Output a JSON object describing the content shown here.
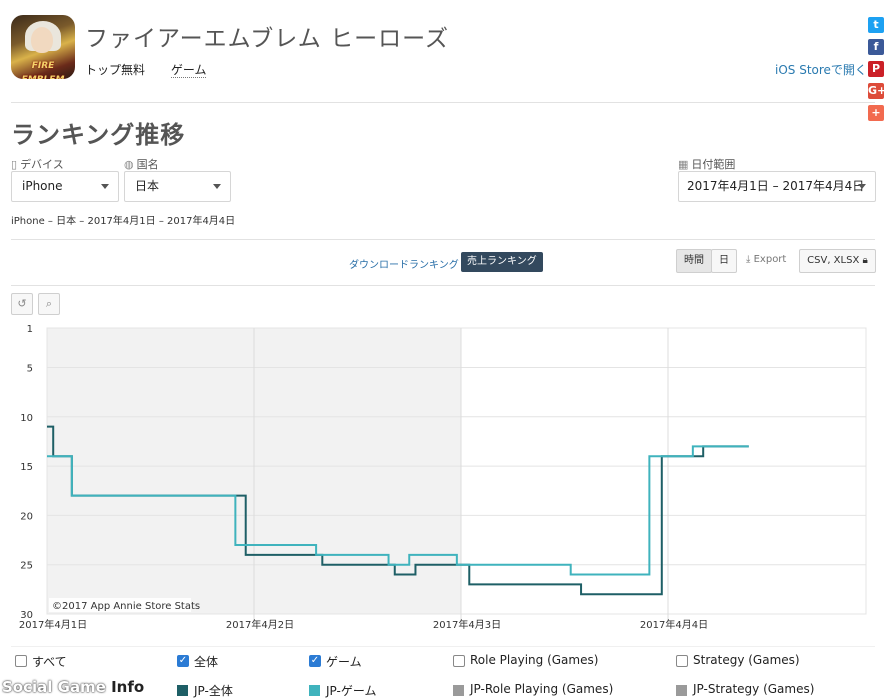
{
  "app": {
    "title": "ファイアーエムブレム ヒーローズ",
    "category": "トップ無料",
    "genre": "ゲーム",
    "store_link": "iOS Storeで開く",
    "icon_text": "FIRE EMBLEM Heroes"
  },
  "social": [
    {
      "name": "twitter-icon",
      "glyph": "t",
      "color": "#1da1f2"
    },
    {
      "name": "facebook-icon",
      "glyph": "f",
      "color": "#3b5998"
    },
    {
      "name": "pinterest-icon",
      "glyph": "P",
      "color": "#cb2027"
    },
    {
      "name": "google-plus-icon",
      "glyph": "G+",
      "color": "#dd4b39"
    },
    {
      "name": "share-plus-icon",
      "glyph": "+",
      "color": "#f26a4f"
    }
  ],
  "section_title": "ランキング推移",
  "filters": {
    "device_label": "デバイス",
    "device_value": "iPhone",
    "country_label": "国名",
    "country_value": "日本",
    "date_label": "日付範囲",
    "date_value": "2017年4月1日 – 2017年4月4日"
  },
  "summary": "iPhone – 日本 – 2017年4月1日 – 2017年4月4日",
  "ranking_tabs": {
    "download": "ダウンロードランキング",
    "revenue": "売上ランキング"
  },
  "buttons": {
    "hourly": "時間",
    "daily": "日",
    "export": "Export",
    "csv": "CSV, XLSX"
  },
  "tools": {
    "reset_glyph": "↺",
    "zoom_glyph": "⌕"
  },
  "chart_data": {
    "type": "line",
    "y_reversed": true,
    "ylim": [
      1,
      30
    ],
    "y_ticks": [
      1,
      5,
      10,
      15,
      20,
      25,
      30
    ],
    "x_range_days": [
      0,
      4
    ],
    "x_ticks": [
      {
        "day": 0,
        "label": "2017年4月1日"
      },
      {
        "day": 1,
        "label": "2017年4月2日"
      },
      {
        "day": 2,
        "label": "2017年4月3日"
      },
      {
        "day": 3,
        "label": "2017年4月4日"
      }
    ],
    "shaded_days": [
      [
        0,
        1
      ],
      [
        1,
        2
      ]
    ],
    "credit": "©2017 App Annie Store Stats",
    "series": [
      {
        "name": "JP-全体",
        "color": "#1e5f66",
        "step": true,
        "points": [
          [
            0.0,
            11
          ],
          [
            0.03,
            14
          ],
          [
            0.08,
            14
          ],
          [
            0.12,
            18
          ],
          [
            0.9,
            18
          ],
          [
            0.96,
            24
          ],
          [
            1.3,
            24
          ],
          [
            1.33,
            25
          ],
          [
            1.65,
            25
          ],
          [
            1.68,
            26
          ],
          [
            1.75,
            26
          ],
          [
            1.78,
            25
          ],
          [
            1.98,
            25
          ],
          [
            2.04,
            27
          ],
          [
            2.55,
            27
          ],
          [
            2.58,
            28
          ],
          [
            2.94,
            28
          ],
          [
            2.97,
            14
          ],
          [
            3.12,
            14
          ],
          [
            3.17,
            13
          ],
          [
            3.39,
            13
          ]
        ]
      },
      {
        "name": "JP-ゲーム",
        "color": "#3fb3bd",
        "step": true,
        "points": [
          [
            0.0,
            14
          ],
          [
            0.08,
            14
          ],
          [
            0.12,
            18
          ],
          [
            0.87,
            18
          ],
          [
            0.91,
            23
          ],
          [
            1.25,
            23
          ],
          [
            1.3,
            24
          ],
          [
            1.6,
            24
          ],
          [
            1.65,
            25
          ],
          [
            1.72,
            25
          ],
          [
            1.75,
            24
          ],
          [
            1.93,
            24
          ],
          [
            1.98,
            25
          ],
          [
            2.5,
            25
          ],
          [
            2.53,
            26
          ],
          [
            2.88,
            26
          ],
          [
            2.91,
            14
          ],
          [
            3.08,
            14
          ],
          [
            3.12,
            13
          ],
          [
            3.39,
            13
          ]
        ]
      }
    ]
  },
  "legend": [
    {
      "label": "すべて",
      "checked": false,
      "series": "JP-全体",
      "swatch": "#1e5f66"
    },
    {
      "label": "全体",
      "checked": true,
      "series": "JP-ゲーム",
      "swatch": "#3fb3bd"
    },
    {
      "label": "ゲーム",
      "checked": true,
      "series": "JP-Role Playing (Games)",
      "swatch": "#9a9a9a"
    },
    {
      "label": "Role Playing (Games)",
      "checked": false,
      "series": "JP-Strategy (Games)",
      "swatch": "#9a9a9a"
    },
    {
      "label": "Strategy (Games)",
      "checked": false
    }
  ],
  "watermark": {
    "text": "Social Game ",
    "suffix": "Info"
  }
}
